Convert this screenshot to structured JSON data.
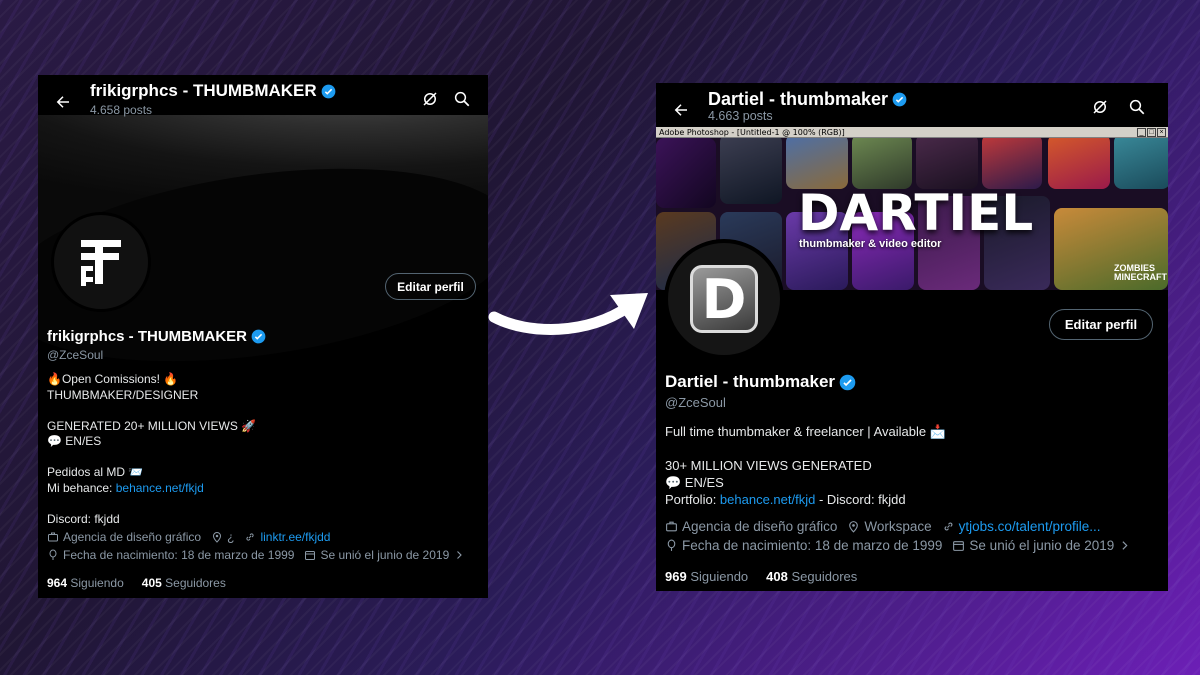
{
  "before": {
    "header": {
      "title": "frikigrphcs - THUMBMAKER",
      "posts": "4.658 posts"
    },
    "edit_profile_label": "Editar perfil",
    "profile": {
      "name": "frikigrphcs - THUMBMAKER",
      "handle": "@ZceSoul"
    },
    "bio": {
      "line1": "🔥Open Comissions! 🔥",
      "line2": "THUMBMAKER/DESIGNER",
      "line3": "GENERATED 20+ MILLION VIEWS 🚀",
      "line4": "💬 EN/ES",
      "line5": "Pedidos al MD 📨",
      "line6_prefix": "Mi behance: ",
      "line6_link": "behance.net/fkjd",
      "line7": "Discord: fkjdd"
    },
    "meta": {
      "category": "Agencia de diseño gráfico",
      "location": "¿",
      "website": "linktr.ee/fkjdd",
      "birthday": "Fecha de nacimiento: 18 de marzo de 1999",
      "joined": "Se unió el junio de 2019"
    },
    "stats": {
      "following_count": "964",
      "following_label": "Siguiendo",
      "followers_count": "405",
      "followers_label": "Seguidores"
    }
  },
  "after": {
    "header": {
      "title": "Dartiel - thumbmaker",
      "posts": "4.663 posts"
    },
    "photoshop_bar": "Adobe Photoshop - [Untitled-1 @ 100% (RGB)]",
    "banner": {
      "big_text": "DARTIEL",
      "subtitle": "thumbmaker & video editor",
      "tile_text_1": "ZOMBIES",
      "tile_text_2": "MINECRAFT"
    },
    "avatar_letter": "D",
    "edit_profile_label": "Editar perfil",
    "profile": {
      "name": "Dartiel - thumbmaker",
      "handle": "@ZceSoul"
    },
    "bio": {
      "line1": "Full time thumbmaker & freelancer | Available 📩",
      "line2": "30+ MILLION VIEWS GENERATED",
      "line3": "💬 EN/ES",
      "line4_prefix": "Portfolio: ",
      "line4_link": "behance.net/fkjd",
      "line4_suffix": " - Discord: fkjdd"
    },
    "meta": {
      "category": "Agencia de diseño gráfico",
      "location": "Workspace",
      "website": "ytjobs.co/talent/profile...",
      "birthday": "Fecha de nacimiento: 18 de marzo de 1999",
      "joined": "Se unió el junio de 2019"
    },
    "stats": {
      "following_count": "969",
      "following_label": "Siguiendo",
      "followers_count": "408",
      "followers_label": "Seguidores"
    }
  },
  "colors": {
    "link": "#1d9bf0",
    "verified": "#1d9bf0",
    "panel_bg": "#000000",
    "muted_text": "#8b98a5"
  }
}
